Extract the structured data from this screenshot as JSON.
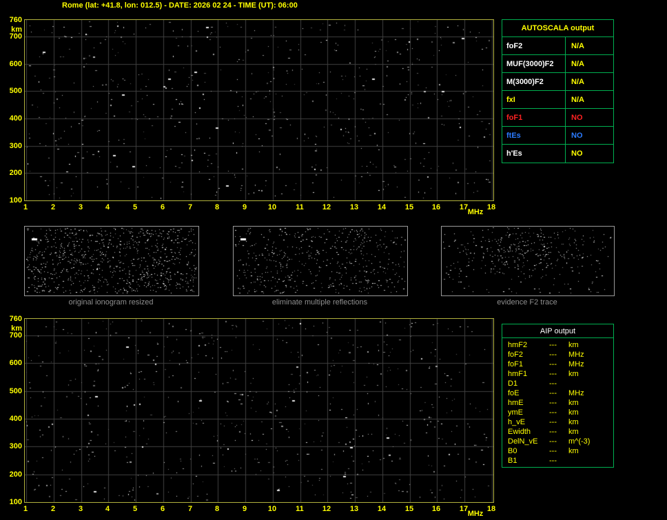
{
  "title": "Rome (lat: +41.8, lon: 012.5) - DATE: 2026 02 24 - TIME (UT): 06:00",
  "chart_data": [
    {
      "type": "scatter",
      "title": "ionogram - AUTOSCALA view (top)",
      "xlabel": "MHz",
      "ylabel": "km",
      "xlim": [
        1,
        18
      ],
      "ylim": [
        100,
        760
      ],
      "x_ticks": [
        1,
        2,
        3,
        4,
        5,
        6,
        7,
        8,
        9,
        10,
        11,
        12,
        13,
        14,
        15,
        16,
        17,
        18
      ],
      "y_ticks": [
        100,
        200,
        300,
        400,
        500,
        600,
        700,
        760
      ],
      "grid": true,
      "series": [],
      "content": "no scaled echo traces; sparse background noise speckle only"
    },
    {
      "type": "scatter",
      "title": "ionogram - AIP view (bottom)",
      "xlabel": "MHz",
      "ylabel": "km",
      "xlim": [
        1,
        18
      ],
      "ylim": [
        100,
        760
      ],
      "x_ticks": [
        1,
        2,
        3,
        4,
        5,
        6,
        7,
        8,
        9,
        10,
        11,
        12,
        13,
        14,
        15,
        16,
        17,
        18
      ],
      "y_ticks": [
        100,
        200,
        300,
        400,
        500,
        600,
        700,
        760
      ],
      "grid": true,
      "series": [],
      "content": "no scaled echo traces; sparse background noise speckle only"
    }
  ],
  "autoscala_table": {
    "header": "AUTOSCALA output",
    "rows": [
      {
        "label": "foF2",
        "value": "N/A",
        "label_color": "#ffffff",
        "value_color": "#ffff00"
      },
      {
        "label": "MUF(3000)F2",
        "value": "N/A",
        "label_color": "#ffffff",
        "value_color": "#ffff00"
      },
      {
        "label": "M(3000)F2",
        "value": "N/A",
        "label_color": "#ffffff",
        "value_color": "#ffff00"
      },
      {
        "label": "fxI",
        "value": "N/A",
        "label_color": "#ffff00",
        "value_color": "#ffff00"
      },
      {
        "label": "foF1",
        "value": "NO",
        "label_color": "#ff2222",
        "value_color": "#ff2222"
      },
      {
        "label": "ftEs",
        "value": "NO",
        "label_color": "#2b7bff",
        "value_color": "#2b7bff"
      },
      {
        "label": "h'Es",
        "value": "NO",
        "label_color": "#ffffff",
        "value_color": "#ffff00"
      }
    ]
  },
  "panels": [
    {
      "caption": "original ionogram resized"
    },
    {
      "caption": "eliminate multiple reflections"
    },
    {
      "caption": "evidence F2 trace"
    }
  ],
  "aip_table": {
    "header": "AIP output",
    "header_color": "#ffffff",
    "text_color": "#ffff00",
    "rows": [
      {
        "name": "hmF2",
        "value": "---",
        "unit": "km"
      },
      {
        "name": "foF2",
        "value": "---",
        "unit": "MHz"
      },
      {
        "name": "foF1",
        "value": "---",
        "unit": "MHz"
      },
      {
        "name": "hmF1",
        "value": "---",
        "unit": "km"
      },
      {
        "name": "D1",
        "value": "---",
        "unit": ""
      },
      {
        "name": "foE",
        "value": "---",
        "unit": "MHz"
      },
      {
        "name": "hmE",
        "value": "---",
        "unit": "km"
      },
      {
        "name": "ymE",
        "value": "---",
        "unit": "km"
      },
      {
        "name": "h_vE",
        "value": "---",
        "unit": "km"
      },
      {
        "name": "Ewidth",
        "value": "---",
        "unit": "km"
      },
      {
        "name": "DelN_vE",
        "value": "---",
        "unit": "m^(-3)"
      },
      {
        "name": "B0",
        "value": "---",
        "unit": "km"
      },
      {
        "name": "B1",
        "value": "---",
        "unit": ""
      }
    ]
  },
  "colors": {
    "background": "#000000",
    "title_text": "#ffff00",
    "axis_label": "#ffff00",
    "plot_border": "#b2b23e",
    "grid": "#404040",
    "table_border": "#00b050",
    "caption_text": "#8f8f8f",
    "panel_border": "#9a9a9a"
  }
}
